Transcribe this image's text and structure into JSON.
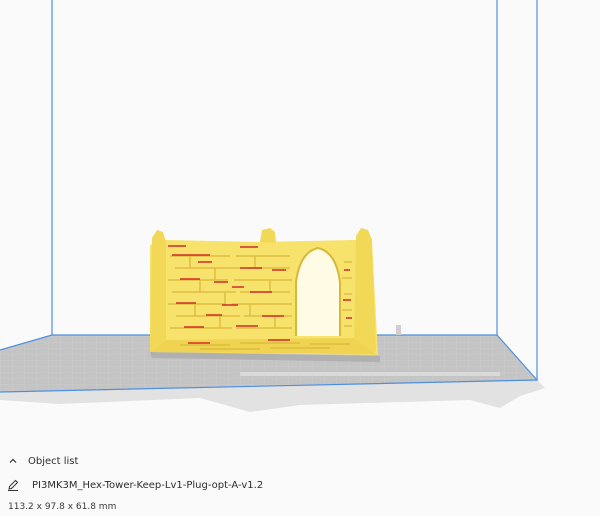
{
  "object_list": {
    "label": "Object list",
    "toggle_icon": "chevron-up-icon"
  },
  "object": {
    "name": "PI3MK3M_Hex-Tower-Keep-Lv1-Plug-opt-A-v1.2",
    "edit_icon": "pencil-icon",
    "dimensions": "113.2 x 97.8 x 61.8 mm"
  },
  "colors": {
    "model": "#f7e26b",
    "model_shadow": "#d9b73a",
    "overhang": "#d42a2a",
    "volume_lines": "#4d8fe0",
    "build_plate": "#b8b8b8"
  }
}
